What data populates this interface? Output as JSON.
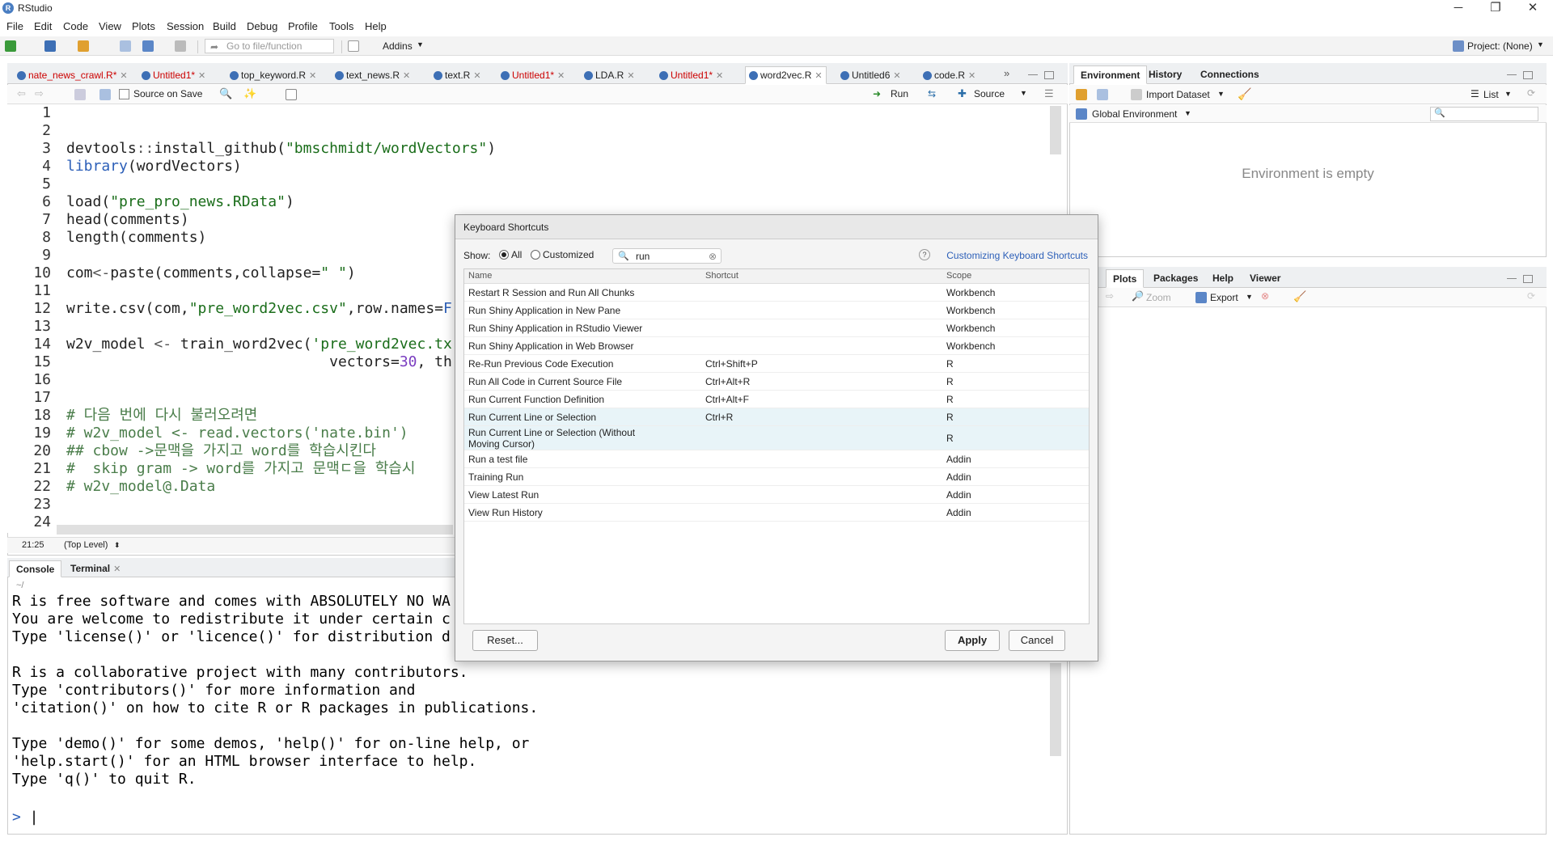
{
  "window": {
    "title": "RStudio"
  },
  "menu": [
    "File",
    "Edit",
    "Code",
    "View",
    "Plots",
    "Session",
    "Build",
    "Debug",
    "Profile",
    "Tools",
    "Help"
  ],
  "toolbar": {
    "goto_placeholder": "Go to file/function",
    "addins": "Addins",
    "project": "Project: (None)"
  },
  "source_tabs": [
    {
      "label": "nate_news_crawl.R*",
      "unsaved": true
    },
    {
      "label": "Untitled1*",
      "unsaved": true
    },
    {
      "label": "top_keyword.R",
      "unsaved": false
    },
    {
      "label": "text_news.R",
      "unsaved": false
    },
    {
      "label": "text.R",
      "unsaved": false
    },
    {
      "label": "Untitled1*",
      "unsaved": true
    },
    {
      "label": "LDA.R",
      "unsaved": false
    },
    {
      "label": "Untitled1*",
      "unsaved": true
    },
    {
      "label": "word2vec.R",
      "unsaved": false,
      "active": true
    },
    {
      "label": "Untitled6",
      "unsaved": false
    },
    {
      "label": "code.R",
      "unsaved": false
    }
  ],
  "editor_toolbar": {
    "source_on_save": "Source on Save",
    "run": "Run",
    "source": "Source"
  },
  "line_numbers": [
    "1",
    "2",
    "3",
    "4",
    "5",
    "6",
    "7",
    "8",
    "9",
    "10",
    "11",
    "12",
    "13",
    "14",
    "15",
    "16",
    "17",
    "18",
    "19",
    "20",
    "21",
    "22",
    "23",
    "24"
  ],
  "status": {
    "position": "21:25",
    "scope": "(Top Level)"
  },
  "console": {
    "tabs": [
      "Console",
      "Terminal"
    ],
    "path": "~/",
    "lines": [
      "R is free software and comes with ABSOLUTELY NO WA",
      "You are welcome to redistribute it under certain c",
      "Type 'license()' or 'licence()' for distribution d",
      "",
      "R is a collaborative project with many contributors.",
      "Type 'contributors()' for more information and",
      "'citation()' on how to cite R or R packages in publications.",
      "",
      "Type 'demo()' for some demos, 'help()' for on-line help, or",
      "'help.start()' for an HTML browser interface to help.",
      "Type 'q()' to quit R."
    ],
    "prompt": ">"
  },
  "env": {
    "tabs": [
      "Environment",
      "History",
      "Connections"
    ],
    "import_dataset": "Import Dataset",
    "list": "List",
    "global_env": "Global Environment",
    "empty": "Environment is empty"
  },
  "plots": {
    "tabs": [
      "Plots",
      "Packages",
      "Help",
      "Viewer"
    ],
    "zoom": "Zoom",
    "export": "Export"
  },
  "dialog": {
    "title": "Keyboard Shortcuts",
    "show_label": "Show:",
    "opt_all": "All",
    "opt_custom": "Customized",
    "search_value": "run",
    "link": "Customizing Keyboard Shortcuts",
    "columns": [
      "Name",
      "Shortcut",
      "Scope"
    ],
    "rows": [
      {
        "name": "Restart R Session and Run All Chunks",
        "shortcut": "",
        "scope": "Workbench"
      },
      {
        "name": "Run Shiny Application in New Pane",
        "shortcut": "",
        "scope": "Workbench"
      },
      {
        "name": "Run Shiny Application in RStudio Viewer",
        "shortcut": "",
        "scope": "Workbench"
      },
      {
        "name": "Run Shiny Application in Web Browser",
        "shortcut": "",
        "scope": "Workbench"
      },
      {
        "name": "Re-Run Previous Code Execution",
        "shortcut": "Ctrl+Shift+P",
        "scope": "R"
      },
      {
        "name": "Run All Code in Current Source File",
        "shortcut": "Ctrl+Alt+R",
        "scope": "R"
      },
      {
        "name": "Run Current Function Definition",
        "shortcut": "Ctrl+Alt+F",
        "scope": "R"
      },
      {
        "name": "Run Current Line or Selection",
        "shortcut": "Ctrl+R",
        "scope": "R"
      },
      {
        "name": "Run Current Line or Selection (Without Moving Cursor)",
        "shortcut": "",
        "scope": "R"
      },
      {
        "name": "Run a test file",
        "shortcut": "",
        "scope": "Addin"
      },
      {
        "name": "Training Run",
        "shortcut": "",
        "scope": "Addin"
      },
      {
        "name": "View Latest Run",
        "shortcut": "",
        "scope": "Addin"
      },
      {
        "name": "View Run History",
        "shortcut": "",
        "scope": "Addin"
      }
    ],
    "reset": "Reset...",
    "apply": "Apply",
    "cancel": "Cancel"
  }
}
